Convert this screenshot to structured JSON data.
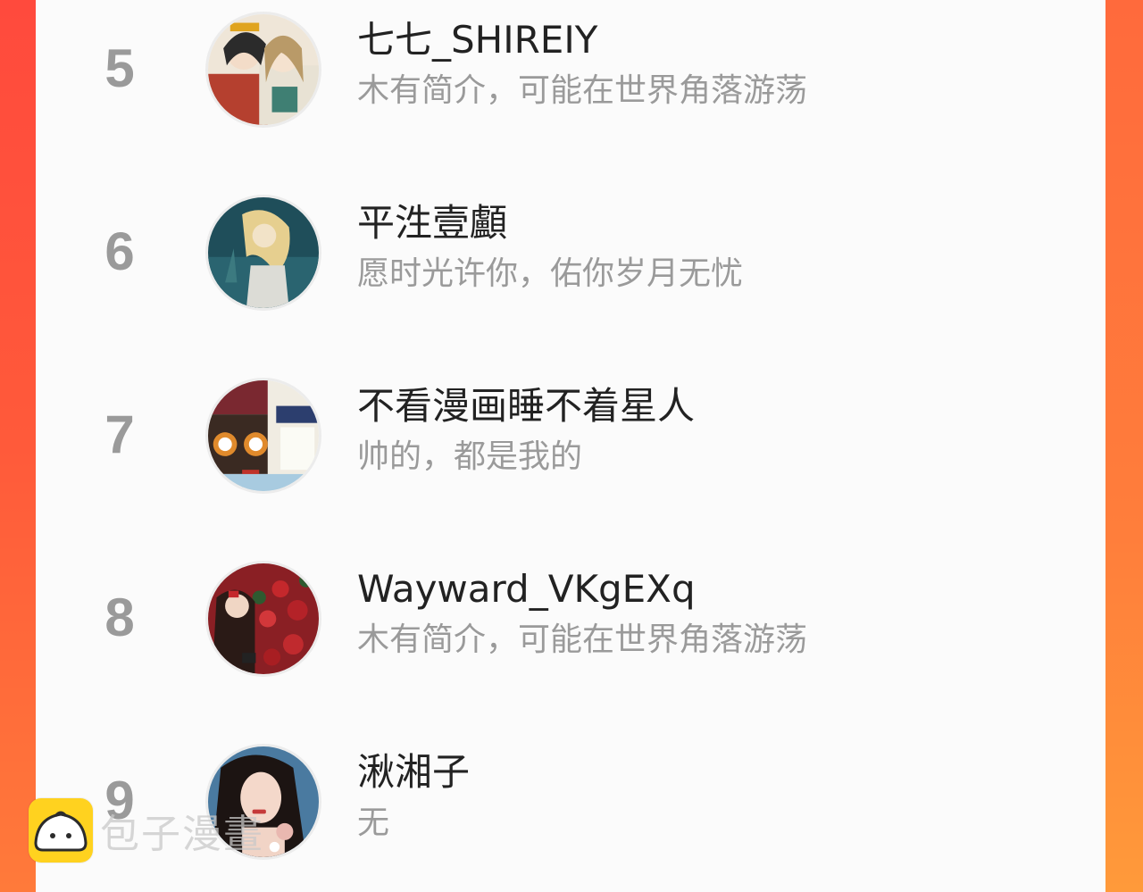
{
  "ranking": [
    {
      "rank": "5",
      "name": "七七_SHIREIY",
      "bio": "木有简介，可能在世界角落游荡"
    },
    {
      "rank": "6",
      "name": "平泩壹顱",
      "bio": "愿时光许你，佑你岁月无忧"
    },
    {
      "rank": "7",
      "name": "不看漫画睡不着星人",
      "bio": "帅的，都是我的"
    },
    {
      "rank": "8",
      "name": "Wayward_VKgEXq",
      "bio": "木有简介，可能在世界角落游荡"
    },
    {
      "rank": "9",
      "name": "湫湘子",
      "bio": "无"
    }
  ],
  "watermark": {
    "text": "包子漫畫",
    "icon": "bun-logo-icon"
  },
  "colors": {
    "accent_left": "#ff4a3d",
    "accent_right": "#ff7e3b",
    "panel": "#fbfbfb",
    "rank": "#9a9a9a",
    "bio": "#9a9a9a"
  }
}
